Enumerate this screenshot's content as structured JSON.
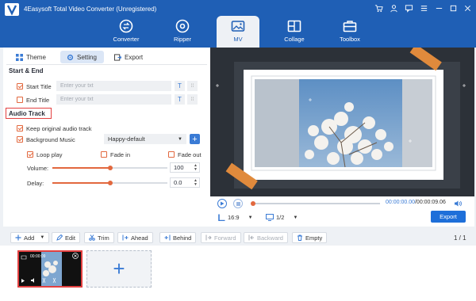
{
  "app": {
    "title": "4Easysoft Total Video Converter (Unregistered)"
  },
  "nav": {
    "items": [
      {
        "label": "Converter",
        "icon": "converter-icon"
      },
      {
        "label": "Ripper",
        "icon": "disc-icon"
      },
      {
        "label": "MV",
        "icon": "mv-icon",
        "active": true
      },
      {
        "label": "Collage",
        "icon": "collage-icon"
      },
      {
        "label": "Toolbox",
        "icon": "toolbox-icon"
      }
    ]
  },
  "tabs": {
    "theme": "Theme",
    "setting": "Setting",
    "export": "Export"
  },
  "start_end": {
    "title": "Start & End",
    "start_title_label": "Start Title",
    "end_title_label": "End Title",
    "placeholder": "Enter your txt"
  },
  "audio": {
    "title": "Audio Track",
    "keep_original": "Keep original audio track",
    "background_music": "Background Music",
    "music_selected": "Happy-default",
    "loop_play": "Loop play",
    "fade_in": "Fade in",
    "fade_out": "Fade out",
    "volume_label": "Volume:",
    "volume_value": "100",
    "volume_level": 0.5,
    "delay_label": "Delay:",
    "delay_value": "0.0",
    "delay_level": 0.5
  },
  "player": {
    "current_time": "00:00:00.00",
    "total_time": "/00:00:09.06",
    "aspect": "16:9",
    "zoom": "1/2",
    "export_label": "Export"
  },
  "toolbar": {
    "add": "Add",
    "edit": "Edit",
    "trim": "Trim",
    "ahead": "Ahead",
    "behind": "Behind",
    "forward": "Forward",
    "backward": "Backward",
    "empty": "Empty",
    "page": "1 / 1"
  },
  "timeline": {
    "clip_duration": "00:00:09"
  },
  "colors": {
    "header": "#1f5fb5",
    "accent_orange": "#e2683e",
    "accent_blue": "#1e6fd9",
    "highlight_red": "#e34040"
  }
}
